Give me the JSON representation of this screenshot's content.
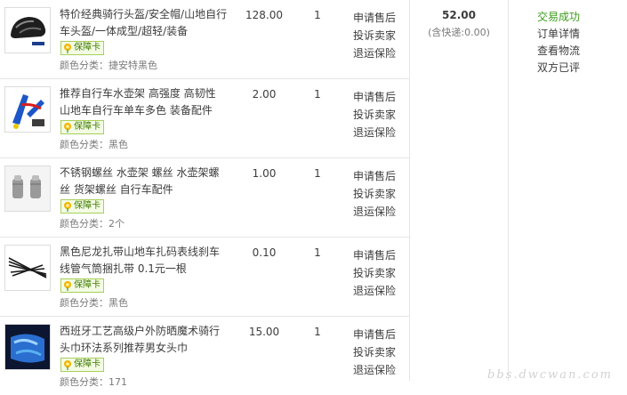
{
  "items": [
    {
      "title": "特价经典骑行头盔/安全帽/山地自行车头盔/一体成型/超轻/装备",
      "badge": "保障卡",
      "attr": "颜色分类：捷安特黑色",
      "price": "128.00",
      "qty": "1",
      "service": [
        "申请售后",
        "投诉卖家",
        "退运保险"
      ],
      "thumb_icon": "helmet-thumbnail"
    },
    {
      "title": "推荐自行车水壶架 高强度 高韧性 山地车自行车单车多色 装备配件",
      "badge": "保障卡",
      "attr": "颜色分类：黑色",
      "price": "2.00",
      "qty": "1",
      "service": [
        "申请售后",
        "投诉卖家",
        "退运保险"
      ],
      "thumb_icon": "bottle-cage-thumbnail"
    },
    {
      "title": "不锈钢螺丝 水壶架 螺丝 水壶架螺丝 货架螺丝 自行车配件",
      "badge": "保障卡",
      "attr": "颜色分类：2个",
      "price": "1.00",
      "qty": "1",
      "service": [
        "申请售后",
        "投诉卖家",
        "退运保险"
      ],
      "thumb_icon": "screws-thumbnail"
    },
    {
      "title": "黑色尼龙扎带山地车扎码表线刹车线管气筒捆扎带 0.1元一根",
      "badge": "保障卡",
      "attr": "颜色分类：黑色",
      "price": "0.10",
      "qty": "1",
      "service": [
        "申请售后",
        "投诉卖家",
        "退运保险"
      ],
      "thumb_icon": "cable-ties-thumbnail"
    },
    {
      "title": "西班牙工艺高级户外防晒魔术骑行头巾环法系列推荐男女头巾",
      "badge": "保障卡",
      "attr": "颜色分类：171",
      "price": "15.00",
      "qty": "1",
      "service": [
        "申请售后",
        "投诉卖家",
        "退运保险"
      ],
      "thumb_icon": "bandana-thumbnail"
    }
  ],
  "order": {
    "total": "52.00",
    "shipping": "(含快递:0.00)",
    "status": "交易成功",
    "links": [
      "订单详情",
      "查看物流",
      "双方已评"
    ]
  },
  "watermark": "bbs.dwcwan.com",
  "colors": {
    "success": "#3d9c1b",
    "border": "#e6e6e6",
    "badge_border": "#a8cf5a"
  }
}
